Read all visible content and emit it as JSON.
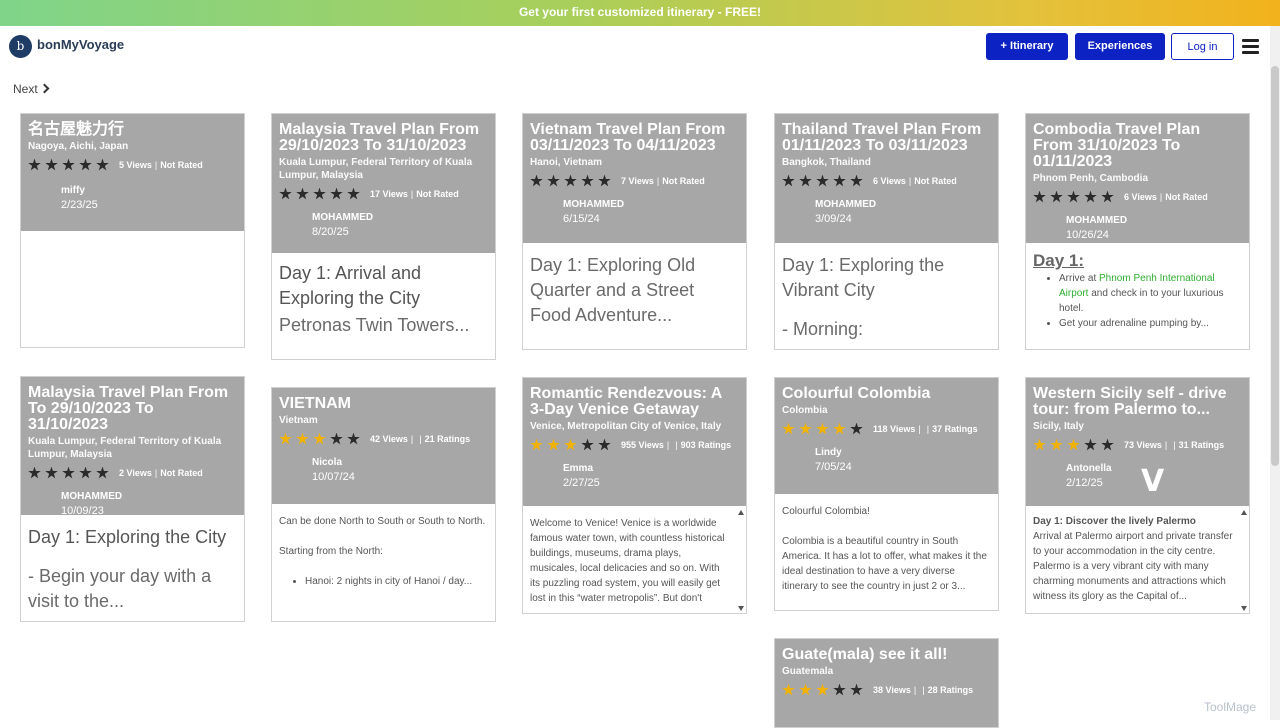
{
  "promo": {
    "text": "Get your first customized itinerary - FREE!"
  },
  "header": {
    "logo_mark": "b",
    "brand": "bonMyVoyage",
    "itinerary_button": "+ Itinerary",
    "experiences_button": "Experiences",
    "login_button": "Log in"
  },
  "pagination": {
    "next": "Next"
  },
  "cards": [
    {
      "title": "名古屋魅力行",
      "location": "Nagoya, Aichi, Japan",
      "views": "5 Views",
      "rating": "Not Rated",
      "author": "miffy",
      "date": "2/23/25"
    },
    {
      "title": "Malaysia Travel Plan From 29/10/2023 To 31/10/2023",
      "location": "Kuala Lumpur, Federal Territory of Kuala Lumpur, Malaysia",
      "views": "17 Views",
      "rating": "Not Rated",
      "author": "MOHAMMED",
      "date": "8/20/25",
      "body_line1": "Day 1: Arrival and Exploring the City",
      "body_line2": "Petronas Twin Towers..."
    },
    {
      "title": "Vietnam Travel Plan From 03/11/2023 To 04/11/2023",
      "location": "Hanoi, Vietnam",
      "views": "7 Views",
      "rating": "Not Rated",
      "author": "MOHAMMED",
      "date": "6/15/24",
      "body": "Day 1: Exploring Old Quarter and a Street Food Adventure..."
    },
    {
      "title": "Thailand Travel Plan From 01/11/2023 To 03/11/2023",
      "location": "Bangkok, Thailand",
      "views": "6 Views",
      "rating": "Not Rated",
      "author": "MOHAMMED",
      "date": "3/09/24",
      "body_line1": "Day 1: Exploring the Vibrant City",
      "body_line2": "- Morning:"
    },
    {
      "title": "Combodia Travel Plan From 31/10/2023 To 01/11/2023",
      "location": "Phnom Penh, Cambodia",
      "views": "6 Views",
      "rating": "Not Rated",
      "author": "MOHAMMED",
      "date": "10/26/24",
      "day_head": "Day 1:",
      "bullet1_pre": "Arrive at ",
      "bullet1_link": "Phnom Penh International Airport",
      "bullet1_post": " and check in to your luxurious hotel.",
      "bullet2": "Get your adrenaline pumping by..."
    },
    {
      "title": "Malaysia Travel Plan From To 29/10/2023  To 31/10/2023",
      "location": "Kuala Lumpur, Federal Territory of Kuala Lumpur, Malaysia",
      "views": "2 Views",
      "rating": "Not Rated",
      "author": "MOHAMMED",
      "date": "10/09/23",
      "body_line1": "Day 1: Exploring the City",
      "body_line2": "- Begin your day with a visit to the..."
    },
    {
      "title": "VIETNAM",
      "location": "Vietnam",
      "views": "42 Views",
      "ratings": "21 Ratings",
      "author": "Nicola",
      "date": "10/07/24",
      "body1": "Can be done North to South or South to North.",
      "body2": "Starting from the North:",
      "bullet": "Hanoi: 2 nights in city of Hanoi / day..."
    },
    {
      "title": "Romantic Rendezvous: A 3-Day Venice Getaway",
      "location": "Venice, Metropolitan City of Venice, Italy",
      "views": "955 Views",
      "ratings": "903 Ratings",
      "author": "Emma",
      "date": "2/27/25",
      "body": "Welcome to Venice! Venice is a worldwide famous water town, with countless historical buildings, museums, drama plays, musicales, local delicacies and so on. With its puzzling road system, you will easily get lost in this “water metropolis”. But don't worry..."
    },
    {
      "title": "Colourful Colombia",
      "location": "Colombia",
      "views": "118 Views",
      "ratings": "37 Ratings",
      "author": "Lindy",
      "date": "7/05/24",
      "body1": "Colourful Colombia!",
      "body2": "Colombia is a beautiful country in South America. It has a lot to offer, what makes it the ideal destination to have a very diverse itinerary to see the country in just 2 or 3..."
    },
    {
      "title": "Western Sicily self - drive tour: from Palermo to...",
      "location": "Sicily, Italy",
      "views": "73 Views",
      "ratings": "31 Ratings",
      "author": "Antonella",
      "date": "2/12/25",
      "body_head": "Day 1: Discover the lively Palermo",
      "body": "Arrival at Palermo airport and private transfer to your accommodation in the city centre. Palermo is a very vibrant city with many charming monuments and attractions which witness its glory as the Capital of..."
    },
    {
      "title": "Guate(mala) see it all!",
      "location": "Guatemala",
      "views": "38 Views",
      "ratings": "28 Ratings"
    }
  ],
  "watermark": "ToolMage"
}
